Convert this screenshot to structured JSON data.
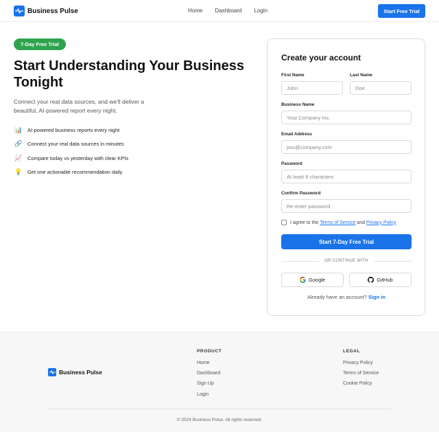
{
  "nav": {
    "brand": "Business Pulse",
    "links": [
      "Home",
      "Dashboard",
      "Login"
    ],
    "cta": "Start Free Trial"
  },
  "hero": {
    "badge": "7-Day Free Trial",
    "title": "Start Understanding Your Business Tonight",
    "subtitle": "Connect your real data sources, and we'll deliver a beautiful, AI-powered report every night.",
    "features": [
      {
        "icon": "bar-chart-icon",
        "glyph": "📊",
        "text": "AI-powered business reports every night"
      },
      {
        "icon": "link-icon",
        "glyph": "🔗",
        "text": "Connect your real data sources in minutes"
      },
      {
        "icon": "trend-chart-icon",
        "glyph": "📈",
        "text": "Compare today vs yesterday with clear KPIs"
      },
      {
        "icon": "lightbulb-icon",
        "glyph": "💡",
        "text": "Get one actionable recommendation daily"
      }
    ]
  },
  "form": {
    "title": "Create your account",
    "first_name_label": "First Name",
    "first_name_placeholder": "John",
    "last_name_label": "Last Name",
    "last_name_placeholder": "Doe",
    "business_label": "Business Name",
    "business_placeholder": "Your Company Inc.",
    "email_label": "Email Address",
    "email_placeholder": "you@company.com",
    "password_label": "Password",
    "password_placeholder": "At least 8 characters",
    "confirm_label": "Confirm Password",
    "confirm_placeholder": "Re-enter password",
    "agree_prefix": "I agree to the",
    "terms_link": "Terms of Service",
    "agree_and": "and",
    "privacy_link": "Privacy Policy",
    "submit": "Start 7-Day Free Trial",
    "divider": "OR CONTINUE WITH",
    "google": "Google",
    "github": "GitHub",
    "signin_prefix": "Already have an account?",
    "signin_link": "Sign in"
  },
  "footer": {
    "brand": "Business Pulse",
    "product_heading": "PRODUCT",
    "product_links": [
      "Home",
      "Dashboard",
      "Sign Up",
      "Login"
    ],
    "legal_heading": "LEGAL",
    "legal_links": [
      "Privacy Policy",
      "Terms of Service",
      "Cookie Policy"
    ],
    "copyright": "© 2024 Business Pulse. All rights reserved."
  },
  "colors": {
    "primary": "#1a73e8",
    "badge": "#2ea44f",
    "footer_bg": "#f7f7f7"
  }
}
